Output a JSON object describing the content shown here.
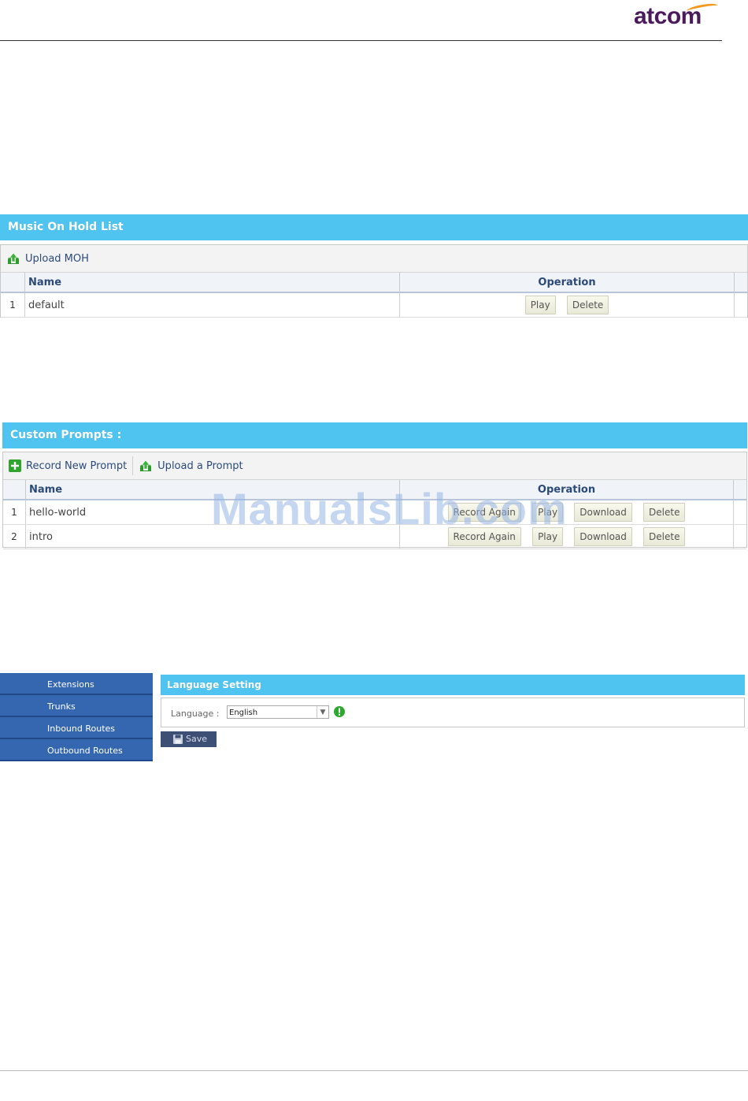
{
  "brand": {
    "logo_text": "atcom"
  },
  "moh": {
    "title": "Music On Hold List",
    "toolbar": {
      "upload_label": "Upload MOH"
    },
    "columns": {
      "name": "Name",
      "operation": "Operation"
    },
    "rows": [
      {
        "num": "1",
        "name": "default",
        "play": "Play",
        "delete": "Delete"
      }
    ]
  },
  "prompts": {
    "title": "Custom Prompts :",
    "toolbar": {
      "record_label": "Record New Prompt",
      "upload_label": "Upload a Prompt"
    },
    "columns": {
      "name": "Name",
      "operation": "Operation"
    },
    "rows": [
      {
        "num": "1",
        "name": "hello-world",
        "record_again": "Record Again",
        "play": "Play",
        "download": "Download",
        "delete": "Delete"
      },
      {
        "num": "2",
        "name": "intro",
        "record_again": "Record Again",
        "play": "Play",
        "download": "Download",
        "delete": "Delete"
      }
    ]
  },
  "sidebar": {
    "items": [
      {
        "label": "Extensions"
      },
      {
        "label": "Trunks"
      },
      {
        "label": "Inbound Routes"
      },
      {
        "label": "Outbound Routes"
      }
    ]
  },
  "language": {
    "title": "Language Setting",
    "field_label": "Language :",
    "selected": "English",
    "save_label": "Save"
  },
  "watermark": "ManualsLib.com",
  "colors": {
    "titlebar": "#4fc4f0",
    "sidebar": "#3566b0",
    "save_button": "#3d4f75",
    "brand": "#4a1a5c"
  }
}
